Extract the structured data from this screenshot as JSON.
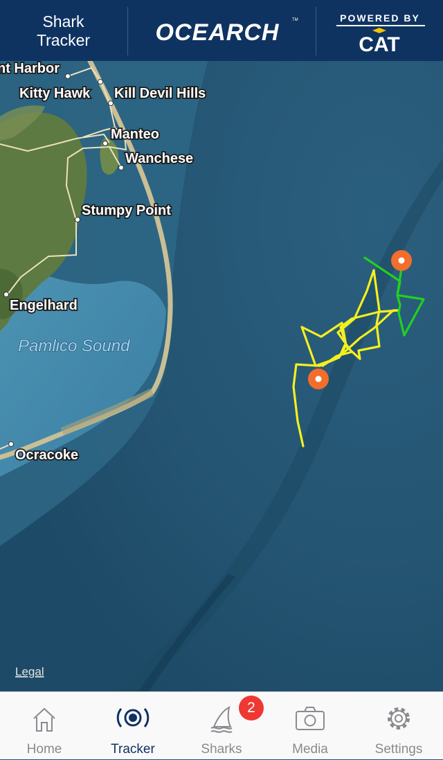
{
  "header": {
    "title_line1": "Shark",
    "title_line2": "Tracker",
    "logo_text": "OCEARCH",
    "trademark": "TM",
    "powered_by": "POWERED BY",
    "sponsor_text": "CAT"
  },
  "map": {
    "places": [
      {
        "name": "nt Harbor"
      },
      {
        "name": "Kitty Hawk"
      },
      {
        "name": "Kill Devil Hills"
      },
      {
        "name": "Manteo"
      },
      {
        "name": "Wanchese"
      },
      {
        "name": "Stumpy Point"
      },
      {
        "name": "Engelhard"
      },
      {
        "name": "Ocracoke"
      }
    ],
    "water_label": "Pamlico Sound",
    "legal_link": "Legal",
    "track_colors": {
      "older": "#f4f01e",
      "recent": "#21d11f"
    },
    "ping_marker_color": "#f36d2b"
  },
  "tabbar": {
    "tabs": [
      {
        "label": "Home",
        "icon": "home-icon",
        "active": false
      },
      {
        "label": "Tracker",
        "icon": "tracker-icon",
        "active": true
      },
      {
        "label": "Sharks",
        "icon": "shark-fin-icon",
        "active": false
      },
      {
        "label": "Media",
        "icon": "camera-icon",
        "active": false
      },
      {
        "label": "Settings",
        "icon": "gear-icon",
        "active": false
      }
    ],
    "sharks_badge": "2",
    "active_color": "#0f3361",
    "inactive_color": "#8a8a8f"
  }
}
